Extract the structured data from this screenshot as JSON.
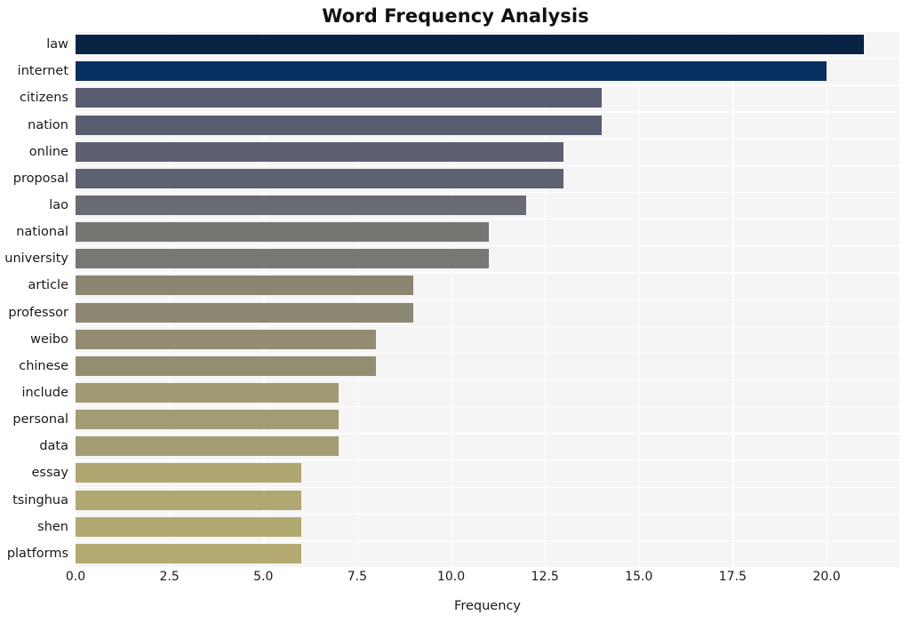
{
  "chart_data": {
    "type": "bar",
    "orientation": "horizontal",
    "title": "Word Frequency Analysis",
    "xlabel": "Frequency",
    "ylabel": "",
    "categories": [
      "law",
      "internet",
      "citizens",
      "nation",
      "online",
      "proposal",
      "lao",
      "national",
      "university",
      "article",
      "professor",
      "weibo",
      "chinese",
      "include",
      "personal",
      "data",
      "essay",
      "tsinghua",
      "shen",
      "platforms"
    ],
    "values": [
      21,
      20,
      14,
      14,
      13,
      13,
      12,
      11,
      11,
      9,
      9,
      8,
      8,
      7,
      7,
      7,
      6,
      6,
      6,
      6
    ],
    "bar_colors": [
      "#0a2344",
      "#06305f",
      "#575c70",
      "#585d70",
      "#5d6070",
      "#5e6171",
      "#696b72",
      "#767673",
      "#777774",
      "#8b8672",
      "#8c8773",
      "#928c72",
      "#938d72",
      "#a29a72",
      "#a39b72",
      "#a49c72",
      "#b0a671",
      "#b1a771",
      "#b2a871",
      "#b3a971"
    ],
    "xticks": [
      "0.0",
      "2.5",
      "5.0",
      "7.5",
      "10.0",
      "12.5",
      "15.0",
      "17.5",
      "20.0"
    ],
    "xtick_values": [
      0,
      2.5,
      5,
      7.5,
      10,
      12.5,
      15,
      17.5,
      20
    ],
    "xlim": [
      0,
      21.94
    ],
    "ylim_count": 20,
    "grid": true,
    "grid_color": "#ffffff",
    "plot_background": "#f5f5f6",
    "figure_background": "#ffffff",
    "legend": null,
    "title_color": "#111111",
    "tick_label_color": "#1a1a1a"
  }
}
